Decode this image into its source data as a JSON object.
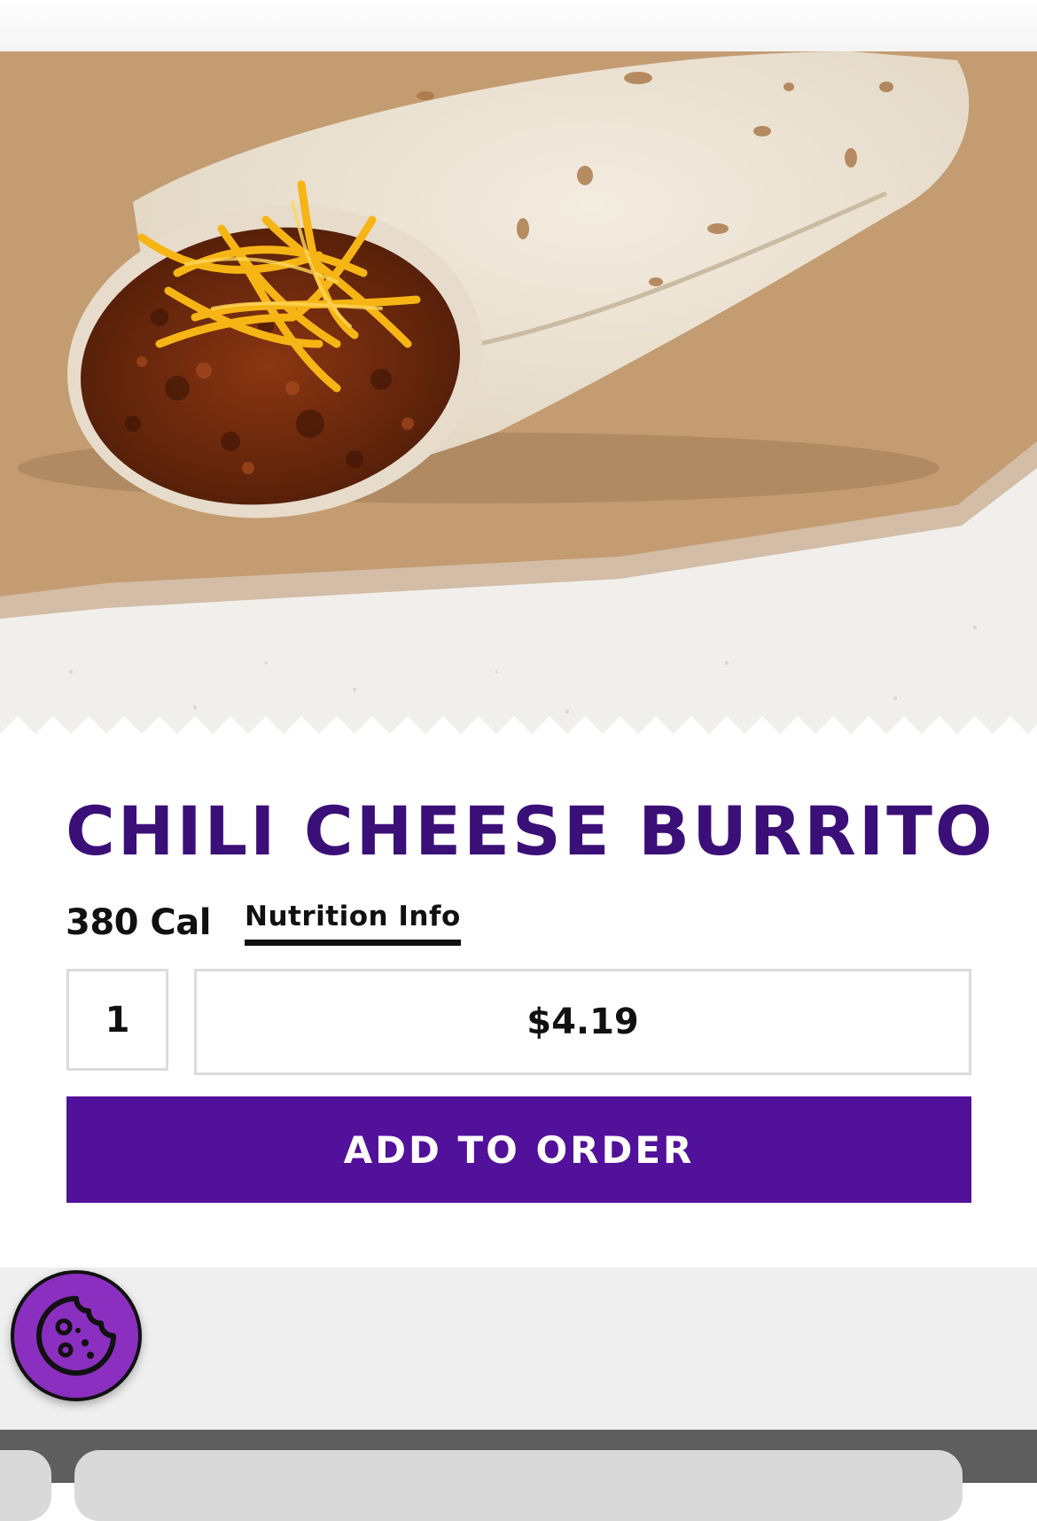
{
  "product": {
    "name": "CHILI CHEESE BURRITO",
    "calories": "380 Cal",
    "nutrition_link": "Nutrition Info",
    "quantity": "1",
    "price": "$4.19"
  },
  "actions": {
    "add_to_order": "ADD TO ORDER"
  },
  "colors": {
    "brand_purple": "#52119a",
    "title_purple": "#3b0f78",
    "cookie_purple": "#8b2fc0"
  },
  "icons": {
    "cookie_button": "cookie-icon"
  }
}
